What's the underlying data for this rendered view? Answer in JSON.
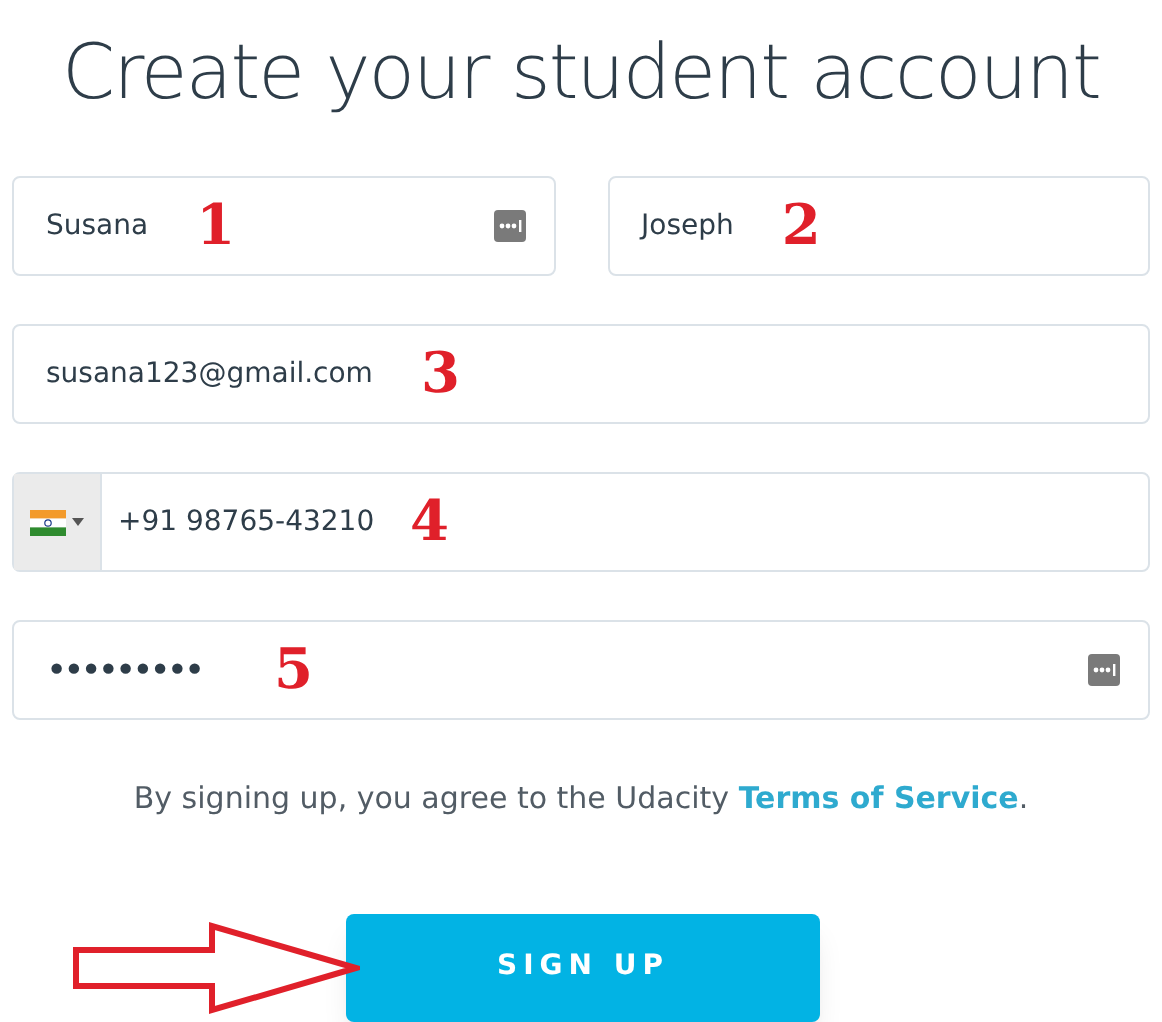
{
  "title": "Create your student account",
  "fields": [
    {
      "kind": "text",
      "value": "Susana",
      "key_icon": true,
      "annotation": "1"
    },
    {
      "kind": "text",
      "value": "Joseph",
      "key_icon": false,
      "annotation": "2"
    },
    {
      "kind": "text",
      "value": "susana123@gmail.com",
      "key_icon": false,
      "annotation": "3"
    },
    {
      "kind": "phone",
      "value": "+91 98765-43210",
      "key_icon": false,
      "annotation": "4"
    },
    {
      "kind": "password",
      "value": "•••••••••",
      "key_icon": true,
      "annotation": "5"
    }
  ],
  "terms": {
    "text": "By signing up, you agree to the Udacity ",
    "link": "Terms of Service",
    "end": "."
  },
  "button": "SIGN UP"
}
